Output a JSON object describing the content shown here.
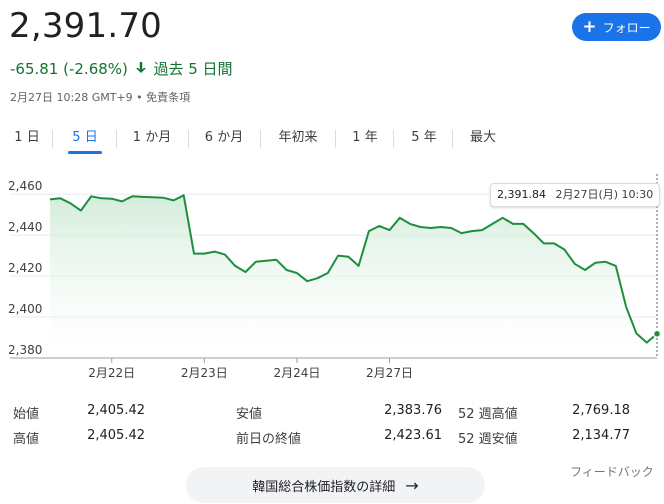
{
  "quote": {
    "price": "2,391.70",
    "change": "-65.81 (-2.68%)",
    "period": "過去 5 日間",
    "timestamp": "2月27日 10:28 GMT+9 • 免責条項",
    "follow_label": "フォロー"
  },
  "tabs": [
    {
      "label": "1 日",
      "active": false
    },
    {
      "label": "5 日",
      "active": true
    },
    {
      "label": "1 か月",
      "active": false
    },
    {
      "label": "6 か月",
      "active": false
    },
    {
      "label": "年初来",
      "active": false
    },
    {
      "label": "1 年",
      "active": false
    },
    {
      "label": "5 年",
      "active": false
    },
    {
      "label": "最大",
      "active": false
    }
  ],
  "tooltip": {
    "value": "2,391.84",
    "datetime": "2月27日(月) 10:30"
  },
  "chart_data": {
    "type": "area",
    "y_ticks": [
      "2,460",
      "2,440",
      "2,420",
      "2,400",
      "2,380"
    ],
    "ylim": [
      2380,
      2465
    ],
    "x_ticks": [
      "2月22日",
      "2月23日",
      "2月24日",
      "2月27日"
    ],
    "x_tick_positions": [
      6,
      15,
      24,
      33
    ],
    "series": [
      {
        "values": [
          2457.5,
          2458,
          2455.5,
          2452,
          2459,
          2458,
          2457.8,
          2456.5,
          2459,
          2458.7,
          2458.5,
          2458.3,
          2457,
          2459.5,
          2431,
          2431,
          2432,
          2430.5,
          2425,
          2422,
          2427,
          2427.5,
          2428,
          2423,
          2421.5,
          2417.5,
          2419,
          2421.5,
          2430,
          2429.5,
          2425,
          2442,
          2444.5,
          2442.5,
          2448.5,
          2445.5,
          2444,
          2443.5,
          2444,
          2443.5,
          2441,
          2442,
          2442.5,
          2445.5,
          2448.5,
          2445.5,
          2445.5,
          2441,
          2436,
          2436,
          2433,
          2426,
          2423,
          2426.5,
          2427,
          2425,
          2405,
          2392,
          2387.5,
          2391.84
        ]
      }
    ],
    "colors": {
      "line": "#1e8e3e",
      "fill_top": "#ceead6",
      "fill_bottom": "#ffffff",
      "grid": "#e8eaed",
      "marker": "#1e8e3e"
    }
  },
  "stats": [
    {
      "label": "始値",
      "value": "2,405.42"
    },
    {
      "label": "高値",
      "value": "2,405.42"
    },
    {
      "label": "安値",
      "value": "2,383.76"
    },
    {
      "label": "前日の終値",
      "value": "2,423.61"
    },
    {
      "label": "52 週高値",
      "value": "2,769.18"
    },
    {
      "label": "52 週安値",
      "value": "2,134.77"
    }
  ],
  "feedback_label": "フィードバック",
  "detail_button_label": "韓国総合株価指数の詳細",
  "icons": {
    "follow": "plus-icon",
    "change": "arrow-down-icon",
    "detail": "arrow-right-icon"
  }
}
